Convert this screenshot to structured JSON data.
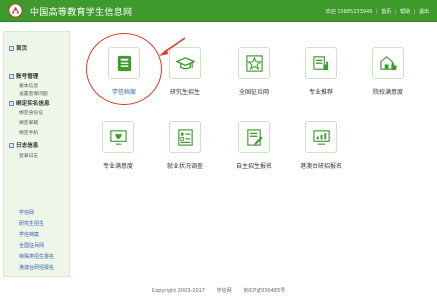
{
  "header": {
    "title": "中国高等教育学生信息网",
    "welcome": "欢迎 15885233949",
    "links": [
      "首页",
      "帮助",
      "退出"
    ],
    "separator": "|"
  },
  "sidebar": {
    "home": "首页",
    "account": {
      "title": "账号管理",
      "items": [
        "基本信息",
        "设置密保问题"
      ]
    },
    "realname": {
      "title": "绑定实名信息",
      "items": [
        "绑定身份证",
        "绑定邮箱",
        "绑定手机"
      ]
    },
    "log": {
      "title": "日志信息",
      "items": [
        "登录日志"
      ]
    },
    "links": [
      "学信网",
      "研究生招生",
      "学信档案",
      "全国征兵网",
      "特殊类招生报名",
      "港澳台研招报名"
    ]
  },
  "tiles": [
    {
      "label": "学信档案",
      "icon": "archive-icon"
    },
    {
      "label": "研究生招生",
      "icon": "graduation-cap-icon"
    },
    {
      "label": "全国征兵网",
      "icon": "star-icon"
    },
    {
      "label": "专业推荐",
      "icon": "recommend-icon"
    },
    {
      "label": "院校满意度",
      "icon": "school-thumbs-up-icon"
    },
    {
      "label": "专业满意度",
      "icon": "heart-screen-icon"
    },
    {
      "label": "就业状况调查",
      "icon": "survey-icon"
    },
    {
      "label": "自主招生报名",
      "icon": "document-edit-icon"
    },
    {
      "label": "港澳台研招报名",
      "icon": "chart-screen-icon"
    }
  ],
  "footer": {
    "copyright": "Copyright 2003-2017",
    "site": "学信网",
    "icp": "京ICP证030485号"
  },
  "colors": {
    "brand": "#3f9a2e",
    "highlight": "#d83a2f",
    "link": "#2f61a8"
  }
}
